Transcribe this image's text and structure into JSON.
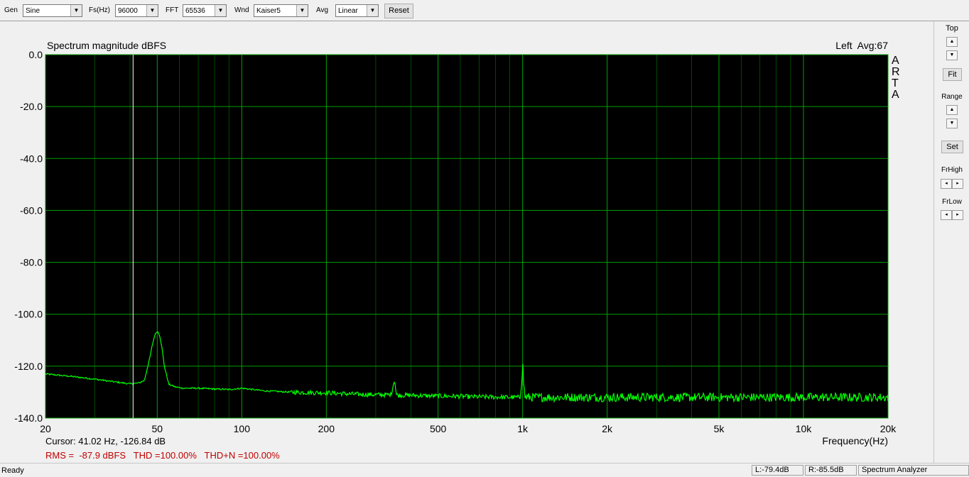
{
  "toolbar": {
    "gen_label": "Gen",
    "gen_value": "Sine",
    "fs_label": "Fs(Hz)",
    "fs_value": "96000",
    "fft_label": "FFT",
    "fft_value": "65536",
    "wnd_label": "Wnd",
    "wnd_value": "Kaiser5",
    "avg_label": "Avg",
    "avg_value": "Linear",
    "reset_label": "Reset"
  },
  "right_panel": {
    "top_label": "Top",
    "fit_label": "Fit",
    "range_label": "Range",
    "set_label": "Set",
    "frhigh_label": "FrHigh",
    "frlow_label": "FrLow"
  },
  "plot": {
    "title": "Spectrum magnitude dBFS",
    "channel_info": "Left  Avg:67",
    "brand_letters": [
      "A",
      "R",
      "T",
      "A"
    ],
    "xlabel": "Frequency(Hz)",
    "cursor_text": "Cursor: 41.02 Hz, -126.84 dB",
    "stats_text": "RMS =  -87.9 dBFS   THD =100.00%   THD+N =100.00%",
    "colors": {
      "background": "#000000",
      "grid": "#00a000",
      "trace": "#00ff00",
      "cursor": "#ffffff",
      "stats": "#c00000"
    }
  },
  "chart_data": {
    "type": "line",
    "title": "Spectrum magnitude dBFS",
    "xlabel": "Frequency(Hz)",
    "ylabel": "",
    "x_scale": "log",
    "xlim": [
      20,
      20000
    ],
    "ylim": [
      -140,
      0
    ],
    "grid": true,
    "y_ticks": [
      0,
      -20,
      -40,
      -60,
      -80,
      -100,
      -120,
      -140
    ],
    "y_tick_labels": [
      "0.0",
      "-20.0",
      "-40.0",
      "-60.0",
      "-80.0",
      "-100.0",
      "-120.0",
      "-140.0"
    ],
    "x_ticks": [
      20,
      50,
      100,
      200,
      500,
      1000,
      2000,
      5000,
      10000,
      20000
    ],
    "x_tick_labels": [
      "20",
      "50",
      "100",
      "200",
      "500",
      "1k",
      "2k",
      "5k",
      "10k",
      "20k"
    ],
    "cursor": {
      "x": 41.02,
      "y": -126.84
    },
    "series": [
      {
        "x": [
          20,
          25,
          30,
          35,
          40,
          43,
          45,
          47,
          48,
          49,
          50,
          51,
          52,
          53,
          55,
          58,
          62,
          70,
          80,
          90,
          100,
          120,
          150,
          180,
          200,
          250,
          300,
          340,
          350,
          355,
          360,
          400,
          450,
          500,
          600,
          650,
          700,
          800,
          900,
          980,
          995,
          1000,
          1005,
          1020,
          1100,
          1200,
          1500,
          2000,
          3000,
          5000,
          7000,
          10000,
          15000,
          20000
        ],
        "y": [
          -123,
          -124,
          -125,
          -126,
          -126.8,
          -126.5,
          -125.5,
          -117,
          -112,
          -108,
          -106.5,
          -108,
          -113,
          -120,
          -127,
          -128,
          -128.5,
          -128.5,
          -128.8,
          -129,
          -128.5,
          -129.5,
          -130,
          -130.2,
          -130.2,
          -130.8,
          -131,
          -131,
          -125,
          -131,
          -131.2,
          -131.2,
          -131.4,
          -131.5,
          -131.6,
          -131.8,
          -131.8,
          -131.9,
          -132,
          -132,
          -125,
          -117,
          -125,
          -132,
          -132,
          -132,
          -132,
          -132,
          -132,
          -132,
          -132,
          -132,
          -132,
          -132
        ]
      }
    ]
  },
  "status": {
    "ready": "Ready",
    "left_level": "L:-79.4dB",
    "right_level": "R:-85.5dB",
    "mode": "Spectrum Analyzer"
  }
}
